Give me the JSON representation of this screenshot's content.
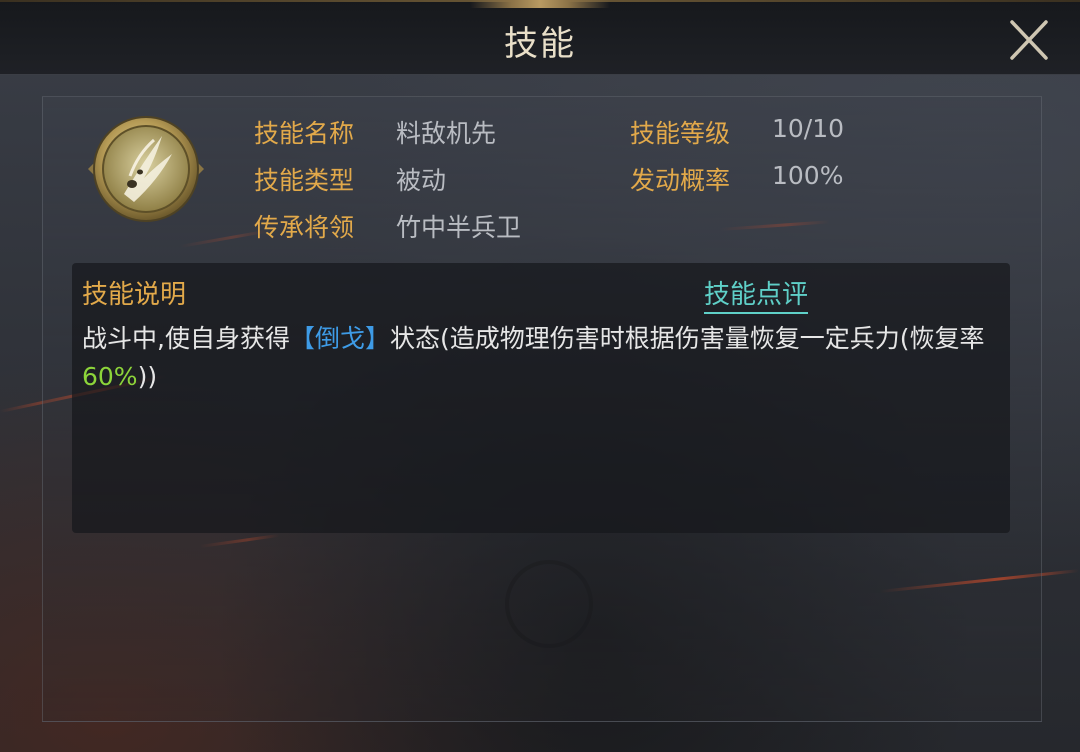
{
  "window": {
    "title": "技能"
  },
  "icons": {
    "close": "close-icon",
    "skill": "skill-emblem-icon"
  },
  "skill": {
    "name_label": "技能名称",
    "name_value": "料敌机先",
    "level_label": "技能等级",
    "level_value": "10/10",
    "type_label": "技能类型",
    "type_value": "被动",
    "chance_label": "发动概率",
    "chance_value": "100%",
    "inherit_label": "传承将领",
    "inherit_value": "竹中半兵卫"
  },
  "description": {
    "title": "技能说明",
    "review_link": "技能点评",
    "text_part1": "战斗中,使自身获得",
    "keyword": "【倒戈】",
    "text_part2": "状态(造成物理伤害时根据伤害量恢复一定兵力(恢复率",
    "percent": "60%",
    "text_part3": "))"
  },
  "colors": {
    "label_gold": "#e2a94a",
    "value_gray": "#b9bcc2",
    "keyword_blue": "#3e9be6",
    "percent_green": "#8cd43a",
    "link_cyan": "#5fd0c8",
    "title_text": "#e9dfc8"
  }
}
